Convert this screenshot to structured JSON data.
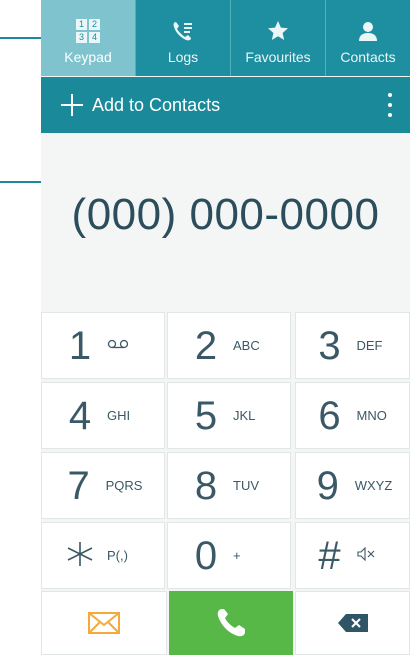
{
  "tabs": [
    {
      "label": "Keypad",
      "icon": "keypad-icon",
      "active": true
    },
    {
      "label": "Logs",
      "icon": "logs-icon",
      "active": false
    },
    {
      "label": "Favourites",
      "icon": "star-icon",
      "active": false
    },
    {
      "label": "Contacts",
      "icon": "person-icon",
      "active": false
    }
  ],
  "keypad_icon_digits": [
    "1",
    "2",
    "3",
    "4"
  ],
  "action_bar": {
    "add_label": "Add to Contacts",
    "add_icon": "plus-icon",
    "more_icon": "more-vertical-icon"
  },
  "number_display": "(000) 000-0000",
  "keys": [
    {
      "digit": "1",
      "letters": "",
      "icon": "voicemail-icon"
    },
    {
      "digit": "2",
      "letters": "ABC"
    },
    {
      "digit": "3",
      "letters": "DEF"
    },
    {
      "digit": "4",
      "letters": "GHI"
    },
    {
      "digit": "5",
      "letters": "JKL"
    },
    {
      "digit": "6",
      "letters": "MNO"
    },
    {
      "digit": "7",
      "letters": "PQRS"
    },
    {
      "digit": "8",
      "letters": "TUV"
    },
    {
      "digit": "9",
      "letters": "WXYZ"
    },
    {
      "digit": "*",
      "letters": "P(,)",
      "icon": "asterisk-icon"
    },
    {
      "digit": "0",
      "letters": "+"
    },
    {
      "digit": "#",
      "letters": "",
      "icon": "mute-icon"
    }
  ],
  "bottom_row": {
    "message_icon": "envelope-icon",
    "call_icon": "phone-icon",
    "delete_icon": "backspace-icon"
  },
  "colors": {
    "tabbar": "#1e8fa0",
    "tab_active": "#7ec3cd",
    "actionbar": "#1a8a9b",
    "digits": "#3a5866",
    "call_green": "#58b847",
    "message_orange": "#f4a93b",
    "delete_dark": "#2f5566"
  }
}
